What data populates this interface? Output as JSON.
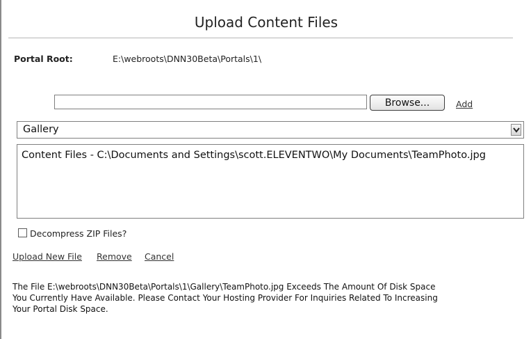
{
  "header": {
    "title": "Upload Content Files"
  },
  "portal_root": {
    "label": "Portal Root:",
    "value": "E:\\webroots\\DNN30Beta\\Portals\\1\\"
  },
  "upload": {
    "file_value": "",
    "browse_label": "Browse...",
    "add_label": "Add"
  },
  "folder_select": {
    "selected": "Gallery"
  },
  "file_list": {
    "items": [
      "Content Files - C:\\Documents and Settings\\scott.ELEVENTWO\\My Documents\\TeamPhoto.jpg"
    ]
  },
  "options": {
    "decompress_label": "Decompress ZIP Files?",
    "decompress_checked": false
  },
  "actions": {
    "upload_new_file": "Upload New File",
    "remove": "Remove",
    "cancel": "Cancel"
  },
  "message": {
    "lines": [
      "The File E:\\webroots\\DNN30Beta\\Portals\\1\\Gallery\\TeamPhoto.jpg Exceeds The Amount Of Disk Space",
      "You Currently Have Available. Please Contact Your Hosting Provider For Inquiries Related To Increasing",
      "Your Portal Disk Space."
    ]
  }
}
